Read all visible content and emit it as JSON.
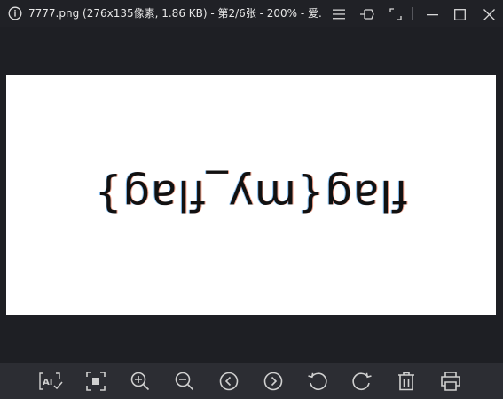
{
  "window": {
    "title": "7777.png (276x135像素, 1.86 KB) - 第2/6张 - 200% - 爱..."
  },
  "image": {
    "text": "flag{my_flag}"
  },
  "toolbar": {
    "tools": [
      "ai-ocr-icon",
      "fit-screen-icon",
      "zoom-in-icon",
      "zoom-out-icon",
      "previous-icon",
      "next-icon",
      "rotate-left-icon",
      "rotate-right-icon",
      "delete-icon",
      "print-icon"
    ]
  },
  "colors": {
    "background": "#1e1f24",
    "toolbar": "#2c2d33",
    "icon": "#d0d0d0"
  }
}
